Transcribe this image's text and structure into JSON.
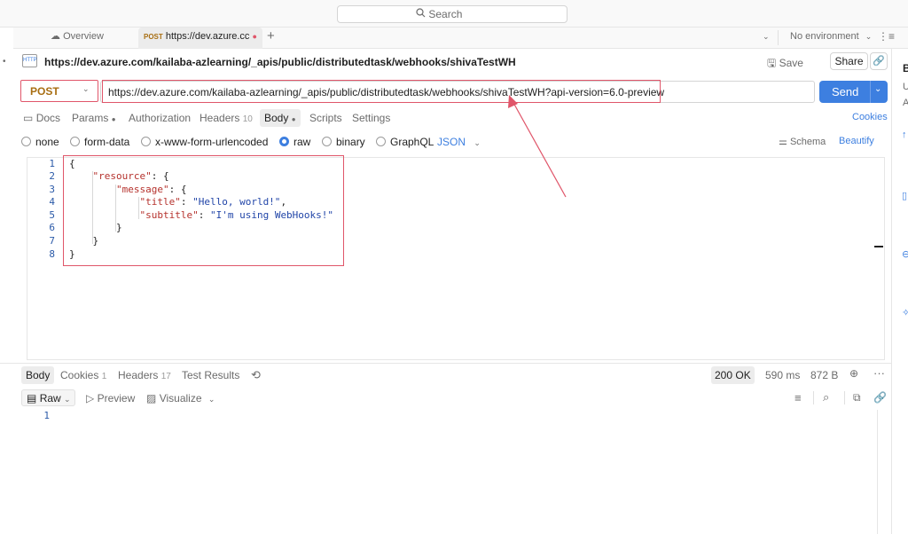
{
  "topbar": {
    "search_placeholder": "Search"
  },
  "tabs": {
    "overview_label": "Overview",
    "active_method": "POST",
    "active_label": "https://dev.azure.cc",
    "add_label": "+",
    "environment": "No environment"
  },
  "request": {
    "title": "https://dev.azure.com/kailaba-azlearning/_apis/public/distributedtask/webhooks/shivaTestWH",
    "save_label": "Save",
    "share_label": "Share",
    "method": "POST",
    "url": "https://dev.azure.com/kailaba-azlearning/_apis/public/distributedtask/webhooks/shivaTestWH?api-version=6.0-preview",
    "send_label": "Send"
  },
  "request_tabs": {
    "docs": "Docs",
    "params": "Params",
    "authorization": "Authorization",
    "headers": "Headers",
    "headers_count": "10",
    "body": "Body",
    "scripts": "Scripts",
    "settings": "Settings",
    "cookies": "Cookies"
  },
  "body_types": {
    "none": "none",
    "form_data": "form-data",
    "urlencoded": "x-www-form-urlencoded",
    "raw": "raw",
    "binary": "binary",
    "graphql": "GraphQL",
    "format": "JSON",
    "schema": "Schema",
    "beautify": "Beautify"
  },
  "editor": {
    "line_numbers": [
      "1",
      "2",
      "3",
      "4",
      "5",
      "6",
      "7",
      "8"
    ],
    "lines": [
      {
        "pre": "{",
        "key": "",
        "mid": "",
        "str": "",
        "post": ""
      },
      {
        "pre": "    ",
        "key": "\"resource\"",
        "mid": ": {",
        "str": "",
        "post": ""
      },
      {
        "pre": "        ",
        "key": "\"message\"",
        "mid": ": {",
        "str": "",
        "post": ""
      },
      {
        "pre": "            ",
        "key": "\"title\"",
        "mid": ": ",
        "str": "\"Hello, world!\"",
        "post": ","
      },
      {
        "pre": "            ",
        "key": "\"subtitle\"",
        "mid": ": ",
        "str": "\"I'm using WebHooks!\"",
        "post": ""
      },
      {
        "pre": "        }",
        "key": "",
        "mid": "",
        "str": "",
        "post": ""
      },
      {
        "pre": "    }",
        "key": "",
        "mid": "",
        "str": "",
        "post": ""
      },
      {
        "pre": "}",
        "key": "",
        "mid": "",
        "str": "",
        "post": ""
      }
    ]
  },
  "response": {
    "body_tab": "Body",
    "cookies_tab": "Cookies",
    "cookies_count": "1",
    "headers_tab": "Headers",
    "headers_count": "17",
    "test_results_tab": "Test Results",
    "status": "200 OK",
    "time": "590 ms",
    "size": "872 B",
    "view_raw": "Raw",
    "view_preview": "Preview",
    "view_visualize": "Visualize",
    "line_number": "1"
  },
  "right_panel": {
    "letters": [
      "B",
      "U",
      "A"
    ]
  },
  "colors": {
    "accent": "#3d7fe0",
    "annotation": "#e0566a",
    "method": "#a86e12"
  }
}
